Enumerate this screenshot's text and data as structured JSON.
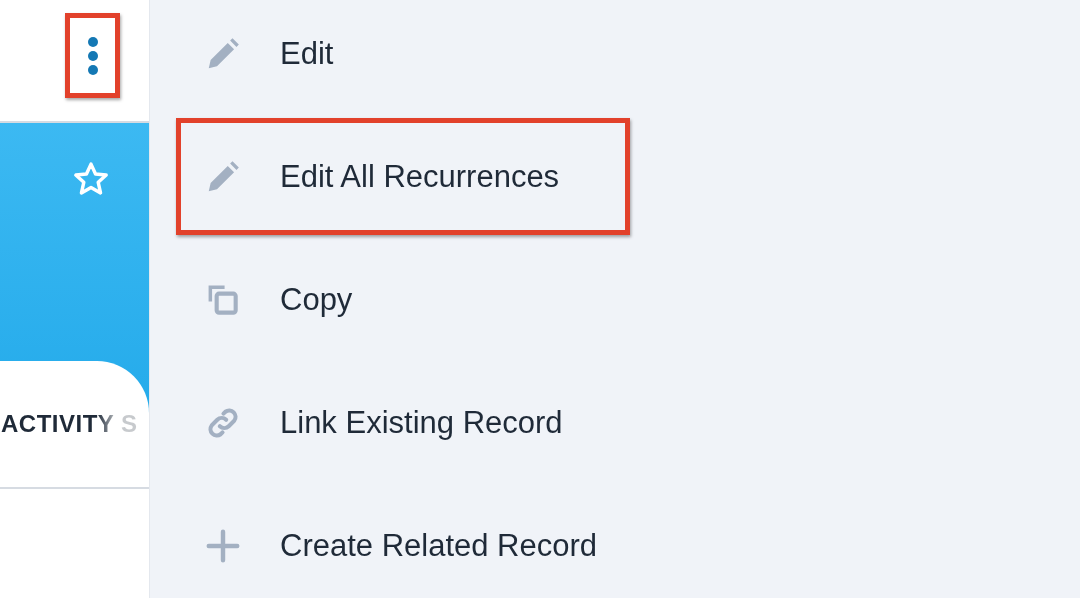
{
  "header": {
    "menu_button": {
      "highlighted": true
    }
  },
  "record": {
    "favorite": false,
    "tab_label": "ACTIVITY S"
  },
  "menu": {
    "items": [
      {
        "kind": "edit",
        "label": "Edit",
        "highlighted": false
      },
      {
        "kind": "edit",
        "label": "Edit All Recurrences",
        "highlighted": true
      },
      {
        "kind": "copy",
        "label": "Copy",
        "highlighted": false
      },
      {
        "kind": "link",
        "label": "Link Existing Record",
        "highlighted": false
      },
      {
        "kind": "add",
        "label": "Create Related Record",
        "highlighted": false
      }
    ]
  }
}
